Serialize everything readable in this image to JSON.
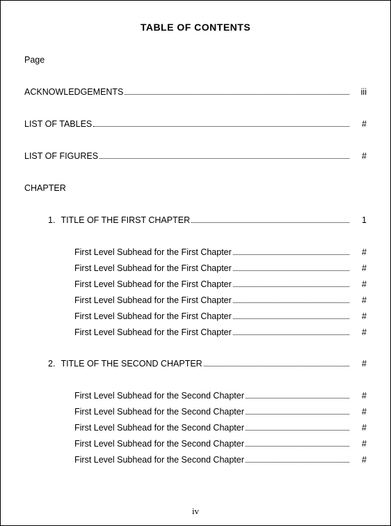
{
  "title": "TABLE OF CONTENTS",
  "page_label": "Page",
  "front": [
    {
      "label": "ACKNOWLEDGEMENTS",
      "page": "iii"
    },
    {
      "label": "LIST OF TABLES",
      "page": "#"
    },
    {
      "label": "LIST OF FIGURES",
      "page": "#"
    }
  ],
  "chapter_label": "CHAPTER",
  "chapters": [
    {
      "num": "1.",
      "title": "TITLE OF THE FIRST CHAPTER",
      "page": "1",
      "subheads": [
        {
          "label": "First Level Subhead for the First Chapter",
          "page": "#"
        },
        {
          "label": "First Level Subhead for the First Chapter",
          "page": "#"
        },
        {
          "label": "First Level Subhead for the First Chapter",
          "page": "#"
        },
        {
          "label": "First Level Subhead for the First Chapter",
          "page": "#"
        },
        {
          "label": "First Level Subhead for the First Chapter",
          "page": "#"
        },
        {
          "label": "First Level Subhead for the First Chapter",
          "page": "#"
        }
      ]
    },
    {
      "num": "2.",
      "title": "TITLE OF THE SECOND CHAPTER",
      "page": "#",
      "subheads": [
        {
          "label": "First Level Subhead for the Second Chapter",
          "page": "#"
        },
        {
          "label": "First Level Subhead for the Second Chapter",
          "page": "#"
        },
        {
          "label": "First Level Subhead for the Second Chapter",
          "page": "#"
        },
        {
          "label": "First Level Subhead for the Second Chapter",
          "page": "#"
        },
        {
          "label": "First Level Subhead for the Second Chapter",
          "page": "#"
        }
      ]
    }
  ],
  "page_number": "iv"
}
